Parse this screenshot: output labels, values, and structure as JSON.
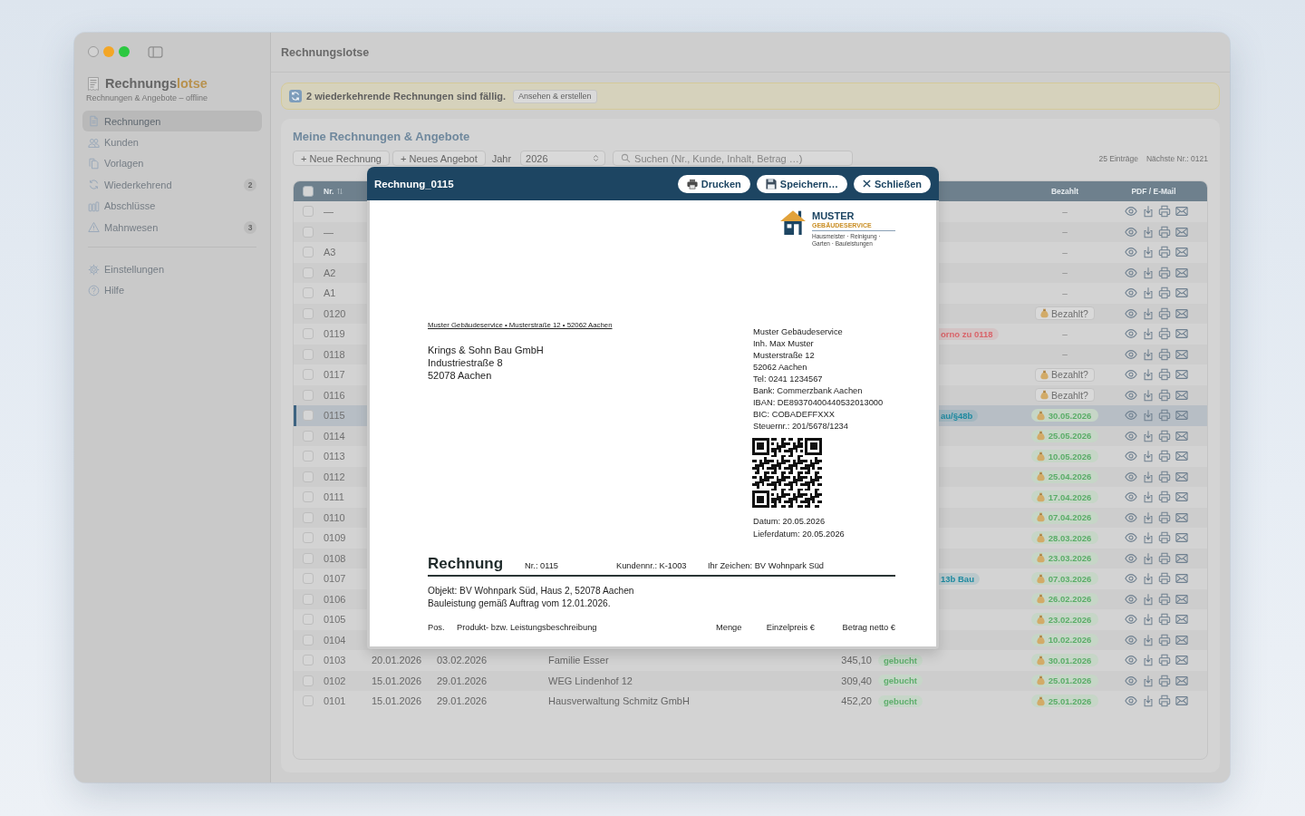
{
  "window": {
    "title": "Rechnungslotse"
  },
  "sidebar": {
    "brand": {
      "name": "Rechnungs",
      "accent": "lotse",
      "subtitle": "Rechnungen & Angebote – offline"
    },
    "items": [
      {
        "label": "Rechnungen",
        "selected": true
      },
      {
        "label": "Kunden",
        "selected": false
      },
      {
        "label": "Vorlagen",
        "selected": false
      },
      {
        "label": "Wiederkehrend",
        "selected": false,
        "badge": "2"
      },
      {
        "label": "Abschlüsse",
        "selected": false
      },
      {
        "label": "Mahnwesen",
        "selected": false,
        "badge": "3"
      }
    ],
    "footer_items": [
      {
        "label": "Einstellungen",
        "selected": false
      },
      {
        "label": "Hilfe",
        "selected": false
      }
    ]
  },
  "banner": {
    "message": "2 wiederkehrende Rechnungen sind fällig.",
    "action": "Ansehen & erstellen"
  },
  "panel": {
    "title": "Meine Rechnungen & Angebote",
    "toolbar": {
      "buttons": [
        "+ Neue Rechnung",
        "+ Neues Angebot"
      ],
      "year": {
        "label": "Jahr",
        "value": "2026"
      },
      "search": {
        "placeholder": "Suchen (Nr., Kunde, Inhalt, Betrag …)"
      },
      "count": "25 Einträge",
      "next_number": "Nächste Nr.: 0121"
    },
    "table": {
      "select_all": {
        "checked": false
      },
      "columns": [
        {
          "kind": "number",
          "label": "Nr."
        },
        {
          "kind": "paid",
          "label": "Bezahlt"
        },
        {
          "kind": "actions",
          "label": "PDF / E-Mail"
        }
      ],
      "rows": [
        {
          "nr": "—",
          "checked": false,
          "selected": false,
          "paid": {
            "kind": "none",
            "text": "–"
          }
        },
        {
          "nr": "—",
          "checked": false,
          "selected": false,
          "paid": {
            "kind": "none",
            "text": "–"
          }
        },
        {
          "nr": "A3",
          "checked": false,
          "selected": false,
          "paid": {
            "kind": "none",
            "text": "–"
          }
        },
        {
          "nr": "A2",
          "checked": false,
          "selected": false,
          "paid": {
            "kind": "none",
            "text": "–"
          }
        },
        {
          "nr": "A1",
          "checked": false,
          "selected": false,
          "paid": {
            "kind": "none",
            "text": "–"
          }
        },
        {
          "nr": "0120",
          "checked": false,
          "selected": false,
          "paid": {
            "kind": "ask",
            "text": "Bezahlt?"
          }
        },
        {
          "nr": "0119",
          "checked": false,
          "selected": false,
          "note": {
            "text": "orno zu 0118",
            "color": "#d9646a"
          },
          "paid": {
            "kind": "none",
            "text": "–"
          }
        },
        {
          "nr": "0118",
          "checked": false,
          "selected": false,
          "paid": {
            "kind": "none",
            "text": "–"
          }
        },
        {
          "nr": "0117",
          "checked": false,
          "selected": false,
          "paid": {
            "kind": "ask",
            "text": "Bezahlt?"
          }
        },
        {
          "nr": "0116",
          "checked": false,
          "selected": false,
          "paid": {
            "kind": "ask",
            "text": "Bezahlt?"
          }
        },
        {
          "nr": "0115",
          "checked": false,
          "selected": true,
          "note": {
            "text": "au/§48b",
            "color": "#1f8aa0"
          },
          "paid": {
            "kind": "date",
            "text": "30.05.2026"
          }
        },
        {
          "nr": "0114",
          "checked": false,
          "selected": false,
          "paid": {
            "kind": "date",
            "text": "25.05.2026"
          }
        },
        {
          "nr": "0113",
          "checked": false,
          "selected": false,
          "paid": {
            "kind": "date",
            "text": "10.05.2026"
          }
        },
        {
          "nr": "0112",
          "checked": false,
          "selected": false,
          "paid": {
            "kind": "date",
            "text": "25.04.2026"
          }
        },
        {
          "nr": "0111",
          "checked": false,
          "selected": false,
          "paid": {
            "kind": "date",
            "text": "17.04.2026"
          }
        },
        {
          "nr": "0110",
          "checked": false,
          "selected": false,
          "paid": {
            "kind": "date",
            "text": "07.04.2026"
          }
        },
        {
          "nr": "0109",
          "checked": false,
          "selected": false,
          "paid": {
            "kind": "date",
            "text": "28.03.2026"
          }
        },
        {
          "nr": "0108",
          "checked": false,
          "selected": false,
          "paid": {
            "kind": "date",
            "text": "23.03.2026"
          }
        },
        {
          "nr": "0107",
          "checked": false,
          "selected": false,
          "note": {
            "text": "13b Bau",
            "color": "#1f8aa0"
          },
          "paid": {
            "kind": "date",
            "text": "07.03.2026"
          }
        },
        {
          "nr": "0106",
          "checked": false,
          "selected": false,
          "paid": {
            "kind": "date",
            "text": "26.02.2026"
          }
        },
        {
          "nr": "0105",
          "checked": false,
          "selected": false,
          "paid": {
            "kind": "date",
            "text": "23.02.2026"
          }
        },
        {
          "nr": "0104",
          "checked": false,
          "selected": false,
          "paid": {
            "kind": "date",
            "text": "10.02.2026"
          }
        },
        {
          "nr": "0103",
          "checked": false,
          "selected": false,
          "date": "20.01.2026",
          "due": "03.02.2026",
          "customer": "Familie Esser",
          "amount": "345,10",
          "status": "gebucht",
          "paid": {
            "kind": "date",
            "text": "30.01.2026"
          }
        },
        {
          "nr": "0102",
          "checked": false,
          "selected": false,
          "date": "15.01.2026",
          "due": "29.01.2026",
          "customer": "WEG Lindenhof 12",
          "amount": "309,40",
          "status": "gebucht",
          "paid": {
            "kind": "date",
            "text": "25.01.2026"
          }
        },
        {
          "nr": "0101",
          "checked": false,
          "selected": false,
          "date": "15.01.2026",
          "due": "29.01.2026",
          "customer": "Hausverwaltung Schmitz GmbH",
          "amount": "452,20",
          "status": "gebucht",
          "paid": {
            "kind": "date",
            "text": "25.01.2026"
          }
        }
      ]
    }
  },
  "preview": {
    "title": "Rechnung_0115",
    "actions": [
      {
        "kind": "print",
        "label": "Drucken"
      },
      {
        "kind": "save",
        "label": "Speichern…"
      },
      {
        "kind": "close",
        "label": "Schließen"
      }
    ],
    "document": {
      "logo": {
        "name": "MUSTER",
        "subtitle": "GEBÄUDESERVICE",
        "tagline": "Hausmeister · Reinigung · Garten · Bauleistungen"
      },
      "sender_line": "Muster Gebäudeservice • Musterstraße 12 • 52062 Aachen",
      "recipient": [
        "Krings & Sohn Bau GmbH",
        "Industriestraße 8",
        "52078 Aachen"
      ],
      "company": [
        "Muster Gebäudeservice",
        "Inh. Max Muster",
        "Musterstraße 12",
        "52062 Aachen",
        "Tel: 0241 1234567",
        "Bank: Commerzbank Aachen",
        "IBAN: DE89370400440532013000",
        "BIC: COBADEFFXXX",
        "Steuernr.: 201/5678/1234"
      ],
      "dates": [
        "Datum: 20.05.2026",
        "Lieferdatum: 20.05.2026"
      ],
      "heading": "Rechnung",
      "meta": [
        "Nr.: 0115",
        "Kundennr.: K-1003",
        "Ihr Zeichen: BV Wohnpark Süd"
      ],
      "intro": [
        "Objekt: BV Wohnpark Süd, Haus 2, 52078 Aachen",
        "Bauleistung gemäß Auftrag vom 12.01.2026."
      ],
      "items_table": {
        "columns": [
          "Pos.",
          "Produkt- bzw. Leistungsbeschreibung",
          "Menge",
          "Einzelpreis €",
          "Betrag netto €"
        ]
      }
    }
  }
}
